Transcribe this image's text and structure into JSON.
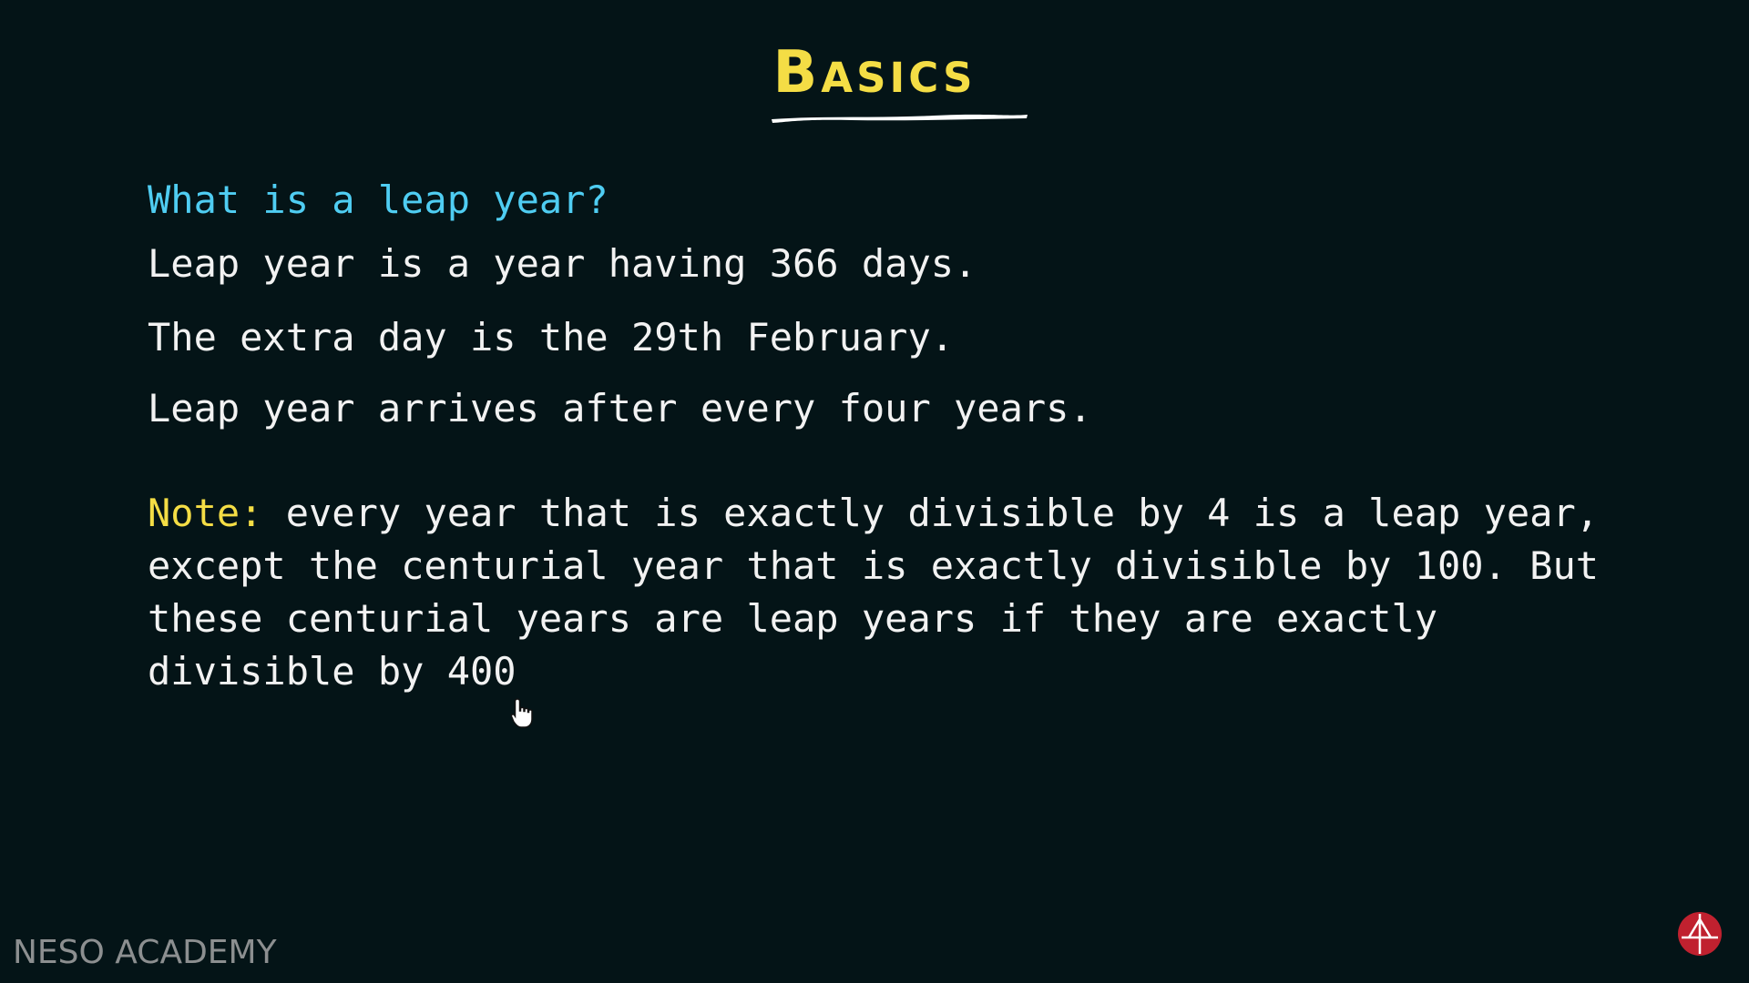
{
  "slide": {
    "title": "Basics",
    "question": "What is a leap year?",
    "facts": [
      "Leap year is a year having 366 days.",
      "The extra day is the 29th February.",
      "Leap year arrives after every four years."
    ],
    "note": {
      "label": "Note:",
      "text": " every year that is exactly divisible by 4 is a leap year, except the centurial year that is exactly divisible by 100. But these centurial years are leap years if they are exactly divisible by 400"
    }
  },
  "branding": {
    "watermark": "NESO ACADEMY",
    "logo_icon": "neso-logo-icon"
  },
  "cursor": {
    "icon": "hand-pointer-icon"
  },
  "colors": {
    "background": "#041417",
    "title": "#f4dd45",
    "question": "#4fcdf2",
    "body_text": "#f2f2f2",
    "note_label": "#f4dd45",
    "watermark": "#8c8f90",
    "logo": "#c0212f"
  }
}
